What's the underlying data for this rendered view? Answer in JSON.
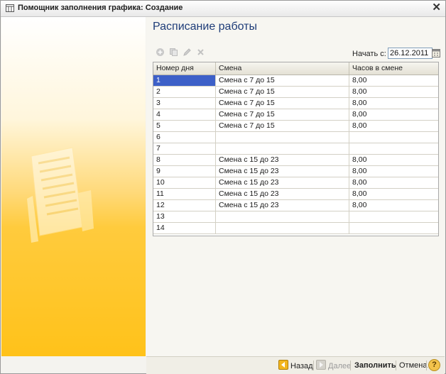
{
  "window": {
    "title": "Помощник заполнения графика: Создание",
    "close_glyph": "✕"
  },
  "page": {
    "title": "Расписание работы"
  },
  "toolbar": {
    "icons": [
      "add-icon",
      "copy-icon",
      "edit-icon",
      "delete-icon"
    ],
    "start_label": "Начать с:",
    "start_date": "26.12.2011"
  },
  "grid": {
    "columns": [
      "Номер дня",
      "Смена",
      "Часов в смене"
    ],
    "rows": [
      [
        "1",
        "Смена с 7 до 15",
        "8,00"
      ],
      [
        "2",
        "Смена с 7 до 15",
        "8,00"
      ],
      [
        "3",
        "Смена с 7 до 15",
        "8,00"
      ],
      [
        "4",
        "Смена с 7 до 15",
        "8,00"
      ],
      [
        "5",
        "Смена с 7 до 15",
        "8,00"
      ],
      [
        "6",
        "",
        ""
      ],
      [
        "7",
        "",
        ""
      ],
      [
        "8",
        "Смена с 15 до 23",
        "8,00"
      ],
      [
        "9",
        "Смена с 15 до 23",
        "8,00"
      ],
      [
        "10",
        "Смена с 15 до 23",
        "8,00"
      ],
      [
        "11",
        "Смена с 15 до 23",
        "8,00"
      ],
      [
        "12",
        "Смена с 15 до 23",
        "8,00"
      ],
      [
        "13",
        "",
        ""
      ],
      [
        "14",
        "",
        ""
      ]
    ],
    "selected_row": 0
  },
  "footer": {
    "back_label": "Назад",
    "next_label": "Далее",
    "fill_label": "Заполнить",
    "cancel_label": "Отмена",
    "help_label": "?"
  },
  "colors": {
    "accent_title": "#1e3c78",
    "selection": "#3d60c8",
    "sidebar": "#ffc21a"
  }
}
